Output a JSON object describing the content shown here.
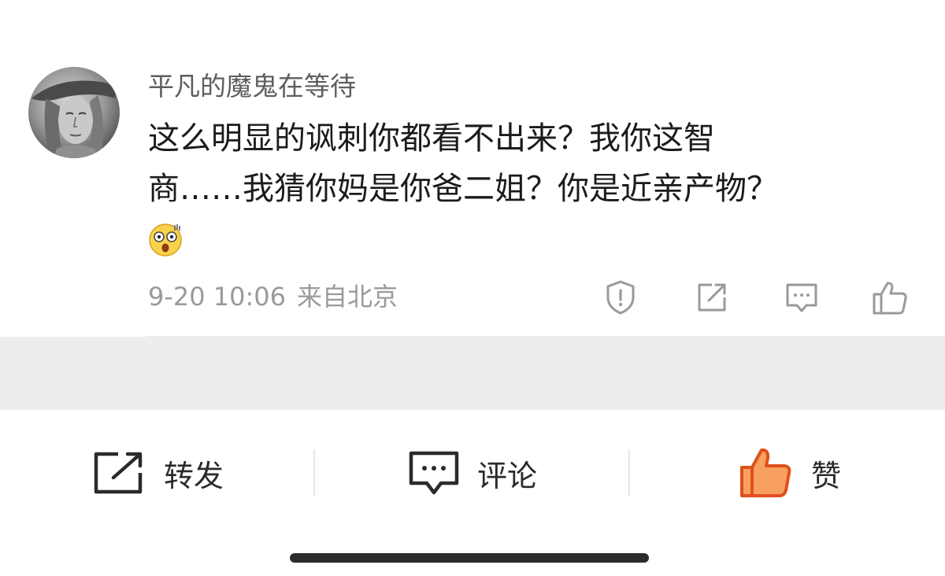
{
  "comment": {
    "username": "平凡的魔鬼在等待",
    "text_line1": "这么明显的讽刺你都看不出来？我你这智",
    "text_line2": "商……我猜你妈是你爸二姐？你是近亲产物？",
    "emoji_icon": "shocked-face-emoji",
    "time": "9-20 10:06",
    "location": "来自北京",
    "actions": [
      "report-icon",
      "share-icon",
      "reply-icon",
      "like-icon"
    ]
  },
  "bottom_bar": {
    "repost_label": "转发",
    "comment_label": "评论",
    "like_label": "赞"
  },
  "colors": {
    "like_accent": "#f0682c",
    "text_primary": "#1b1b1b",
    "text_secondary": "#9a9a9a",
    "band_gray": "#ededed"
  }
}
